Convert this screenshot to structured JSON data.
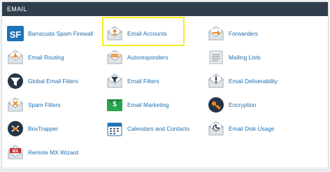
{
  "section": {
    "title": "EMAIL"
  },
  "items": [
    {
      "label": "Barracuda Spam Firewall",
      "icon": "barracuda-sf-icon",
      "col": 1,
      "row": 1
    },
    {
      "label": "Email Accounts",
      "icon": "email-accounts-icon",
      "col": 2,
      "row": 1,
      "highlighted": true
    },
    {
      "label": "Forwarders",
      "icon": "forwarders-icon",
      "col": 3,
      "row": 1
    },
    {
      "label": "Email Routing",
      "icon": "email-routing-icon",
      "col": 1,
      "row": 2
    },
    {
      "label": "Autoresponders",
      "icon": "autoresponders-icon",
      "col": 2,
      "row": 2
    },
    {
      "label": "Mailing Lists",
      "icon": "mailing-lists-icon",
      "col": 3,
      "row": 2
    },
    {
      "label": "Global Email Filters",
      "icon": "global-email-filters-icon",
      "col": 1,
      "row": 3
    },
    {
      "label": "Email Filters",
      "icon": "email-filters-icon",
      "col": 2,
      "row": 3
    },
    {
      "label": "Email Deliverability",
      "icon": "email-deliverability-icon",
      "col": 3,
      "row": 3
    },
    {
      "label": "Spam Filters",
      "icon": "spam-filters-icon",
      "col": 1,
      "row": 4
    },
    {
      "label": "Email Marketing",
      "icon": "email-marketing-icon",
      "col": 2,
      "row": 4
    },
    {
      "label": "Encryption",
      "icon": "encryption-key-icon",
      "col": 3,
      "row": 4
    },
    {
      "label": "BoxTrapper",
      "icon": "boxtrapper-icon",
      "col": 1,
      "row": 5
    },
    {
      "label": "Calendars and Contacts",
      "icon": "calendars-contacts-icon",
      "col": 2,
      "row": 5
    },
    {
      "label": "Email Disk Usage",
      "icon": "email-disk-usage-icon",
      "col": 3,
      "row": 5
    },
    {
      "label": "Remote MX Wizard",
      "icon": "remote-mx-wizard-icon",
      "col": 1,
      "row": 6
    }
  ],
  "colors": {
    "header_bg": "#2f3d4c",
    "link": "#1d6fb1",
    "highlight": "#f4ee1e",
    "icon_orange": "#f08a24",
    "icon_dark": "#253545",
    "icon_blue": "#1f73b7",
    "icon_green": "#2aa44f"
  }
}
